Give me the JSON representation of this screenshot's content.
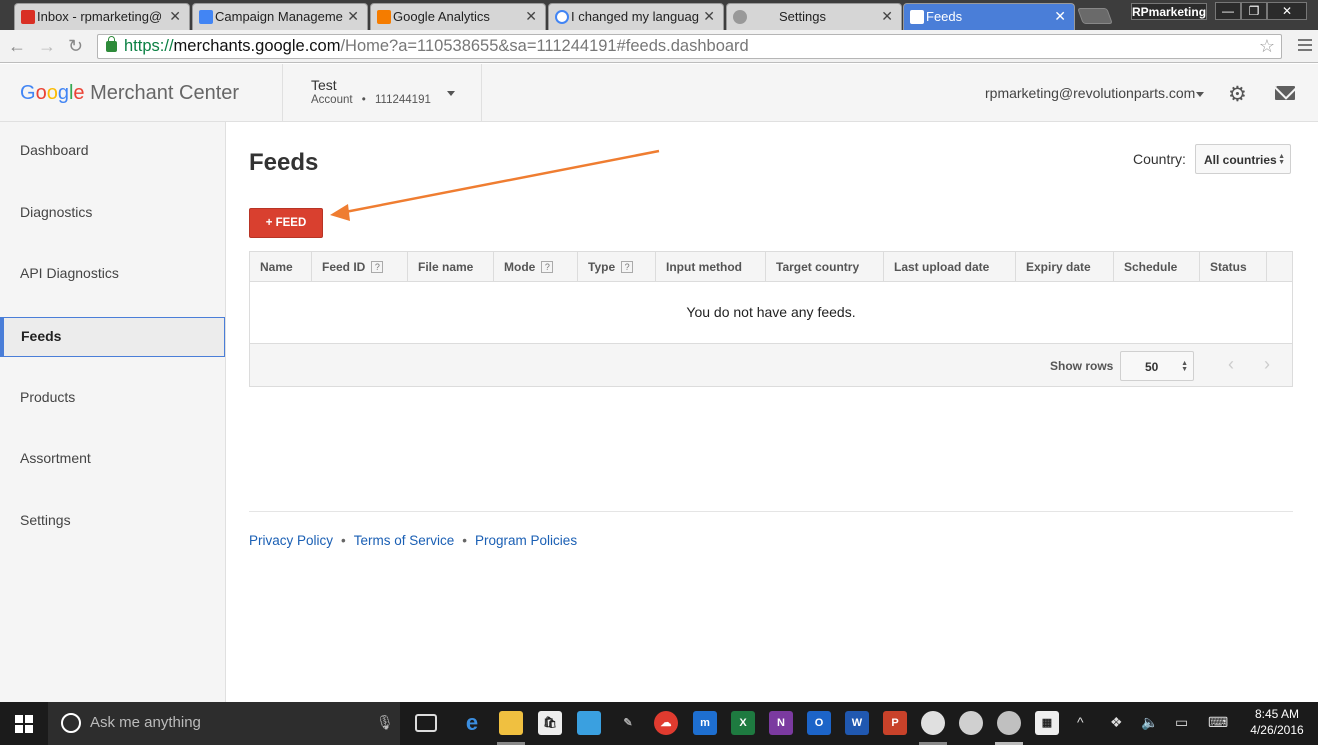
{
  "browser": {
    "tabs": [
      {
        "title": "Inbox - rpmarketing@",
        "icon": "gmail-icon",
        "color": "#d93025"
      },
      {
        "title": "Campaign Manageme",
        "icon": "adwords-icon",
        "color": "#4285f4"
      },
      {
        "title": "Google Analytics",
        "icon": "analytics-icon",
        "color": "#f57c00"
      },
      {
        "title": "I changed my languag",
        "icon": "google-icon",
        "color": "#ffffff"
      },
      {
        "title": "Settings",
        "icon": "settings-gear-icon",
        "color": "#888888"
      },
      {
        "title": "Feeds",
        "icon": "merchant-center-icon",
        "color": "#4285f4"
      }
    ],
    "profile_name": "RPmarketing",
    "url": {
      "scheme": "https://",
      "host": "merchants.google.com",
      "path": "/Home?a=110538655&sa=111244191#feeds.dashboard"
    }
  },
  "header": {
    "logo_google": [
      "G",
      "o",
      "o",
      "g",
      "l",
      "e"
    ],
    "logo_product": "Merchant Center",
    "account_name": "Test",
    "account_label": "Account",
    "account_separator": "•",
    "account_id": "111244191",
    "user_email": "rpmarketing@revolutionparts.com"
  },
  "sidebar": {
    "items": [
      {
        "label": "Dashboard",
        "active": false
      },
      {
        "label": "Diagnostics",
        "active": false
      },
      {
        "label": "API Diagnostics",
        "active": false
      },
      {
        "label": "Feeds",
        "active": true
      },
      {
        "label": "Products",
        "active": false
      },
      {
        "label": "Assortment",
        "active": false
      },
      {
        "label": "Settings",
        "active": false
      }
    ]
  },
  "main": {
    "title": "Feeds",
    "country_label": "Country:",
    "country_value": "All countries",
    "add_feed_label": "+ FEED",
    "table": {
      "columns": [
        {
          "label": "Name",
          "help": false
        },
        {
          "label": "Feed ID",
          "help": true
        },
        {
          "label": "File name",
          "help": false
        },
        {
          "label": "Mode",
          "help": true
        },
        {
          "label": "Type",
          "help": true
        },
        {
          "label": "Input method",
          "help": false
        },
        {
          "label": "Target country",
          "help": false
        },
        {
          "label": "Last upload date",
          "help": false
        },
        {
          "label": "Expiry date",
          "help": false
        },
        {
          "label": "Schedule",
          "help": false
        },
        {
          "label": "Status",
          "help": false
        }
      ],
      "help_glyph": "?",
      "empty_message": "You do not have any feeds.",
      "show_rows_label": "Show rows",
      "rows_value": "50"
    }
  },
  "footer": {
    "links": [
      "Privacy Policy",
      "Terms of Service",
      "Program Policies"
    ],
    "separator": "•"
  },
  "taskbar": {
    "search_placeholder": "Ask me anything",
    "time": "8:45 AM",
    "date": "4/26/2016"
  },
  "colors": {
    "accent_red": "#d9402f",
    "annotation_arrow": "#ef7d31",
    "active_nav_border": "#4a7ed8",
    "link_blue": "#1a5fb4"
  }
}
